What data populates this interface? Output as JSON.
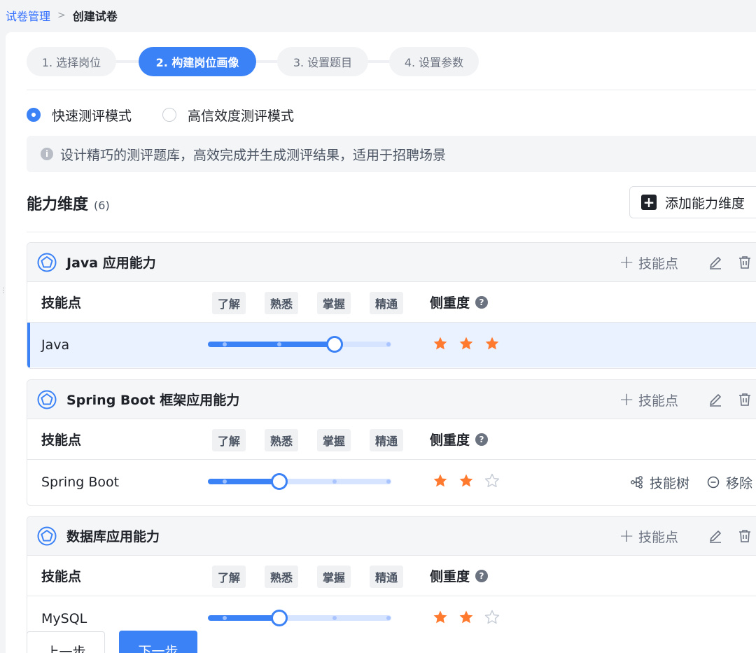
{
  "breadcrumb": {
    "parent": "试卷管理",
    "separator": ">",
    "current": "创建试卷"
  },
  "steps": [
    {
      "label": "1. 选择岗位",
      "active": false
    },
    {
      "label": "2. 构建岗位画像",
      "active": true
    },
    {
      "label": "3. 设置题目",
      "active": false
    },
    {
      "label": "4. 设置参数",
      "active": false
    }
  ],
  "mode": {
    "options": [
      {
        "label": "快速测评模式",
        "selected": true
      },
      {
        "label": "高信效度测评模式",
        "selected": false
      }
    ],
    "info_text": "设计精巧的测评题库，高效完成并生成测评结果，适用于招聘场景"
  },
  "section": {
    "title": "能力维度",
    "count": "(6)",
    "add_label": "添加能力维度"
  },
  "table_headers": {
    "skill": "技能点",
    "levels": [
      "了解",
      "熟悉",
      "掌握",
      "精通"
    ],
    "weight": "侧重度"
  },
  "groups": [
    {
      "name": "Java 应用能力",
      "add_skill_label": "技能点",
      "rows": [
        {
          "name": "Java",
          "level": 3,
          "stars": 3,
          "selected": true
        }
      ]
    },
    {
      "name": "Spring Boot 框架应用能力",
      "add_skill_label": "技能点",
      "rows": [
        {
          "name": "Spring Boot",
          "level": 2,
          "stars": 2,
          "selected": false,
          "actions": [
            "技能树",
            "移除"
          ]
        }
      ]
    },
    {
      "name": "数据库应用能力",
      "add_skill_label": "技能点",
      "rows": [
        {
          "name": "MySQL",
          "level": 2,
          "stars": 2,
          "selected": false
        }
      ]
    }
  ],
  "footer": {
    "prev": "上一步",
    "next": "下一步"
  },
  "colors": {
    "primary": "#3b82f6",
    "star": "#ff7a2f",
    "star_empty": "#c7cdd6"
  }
}
